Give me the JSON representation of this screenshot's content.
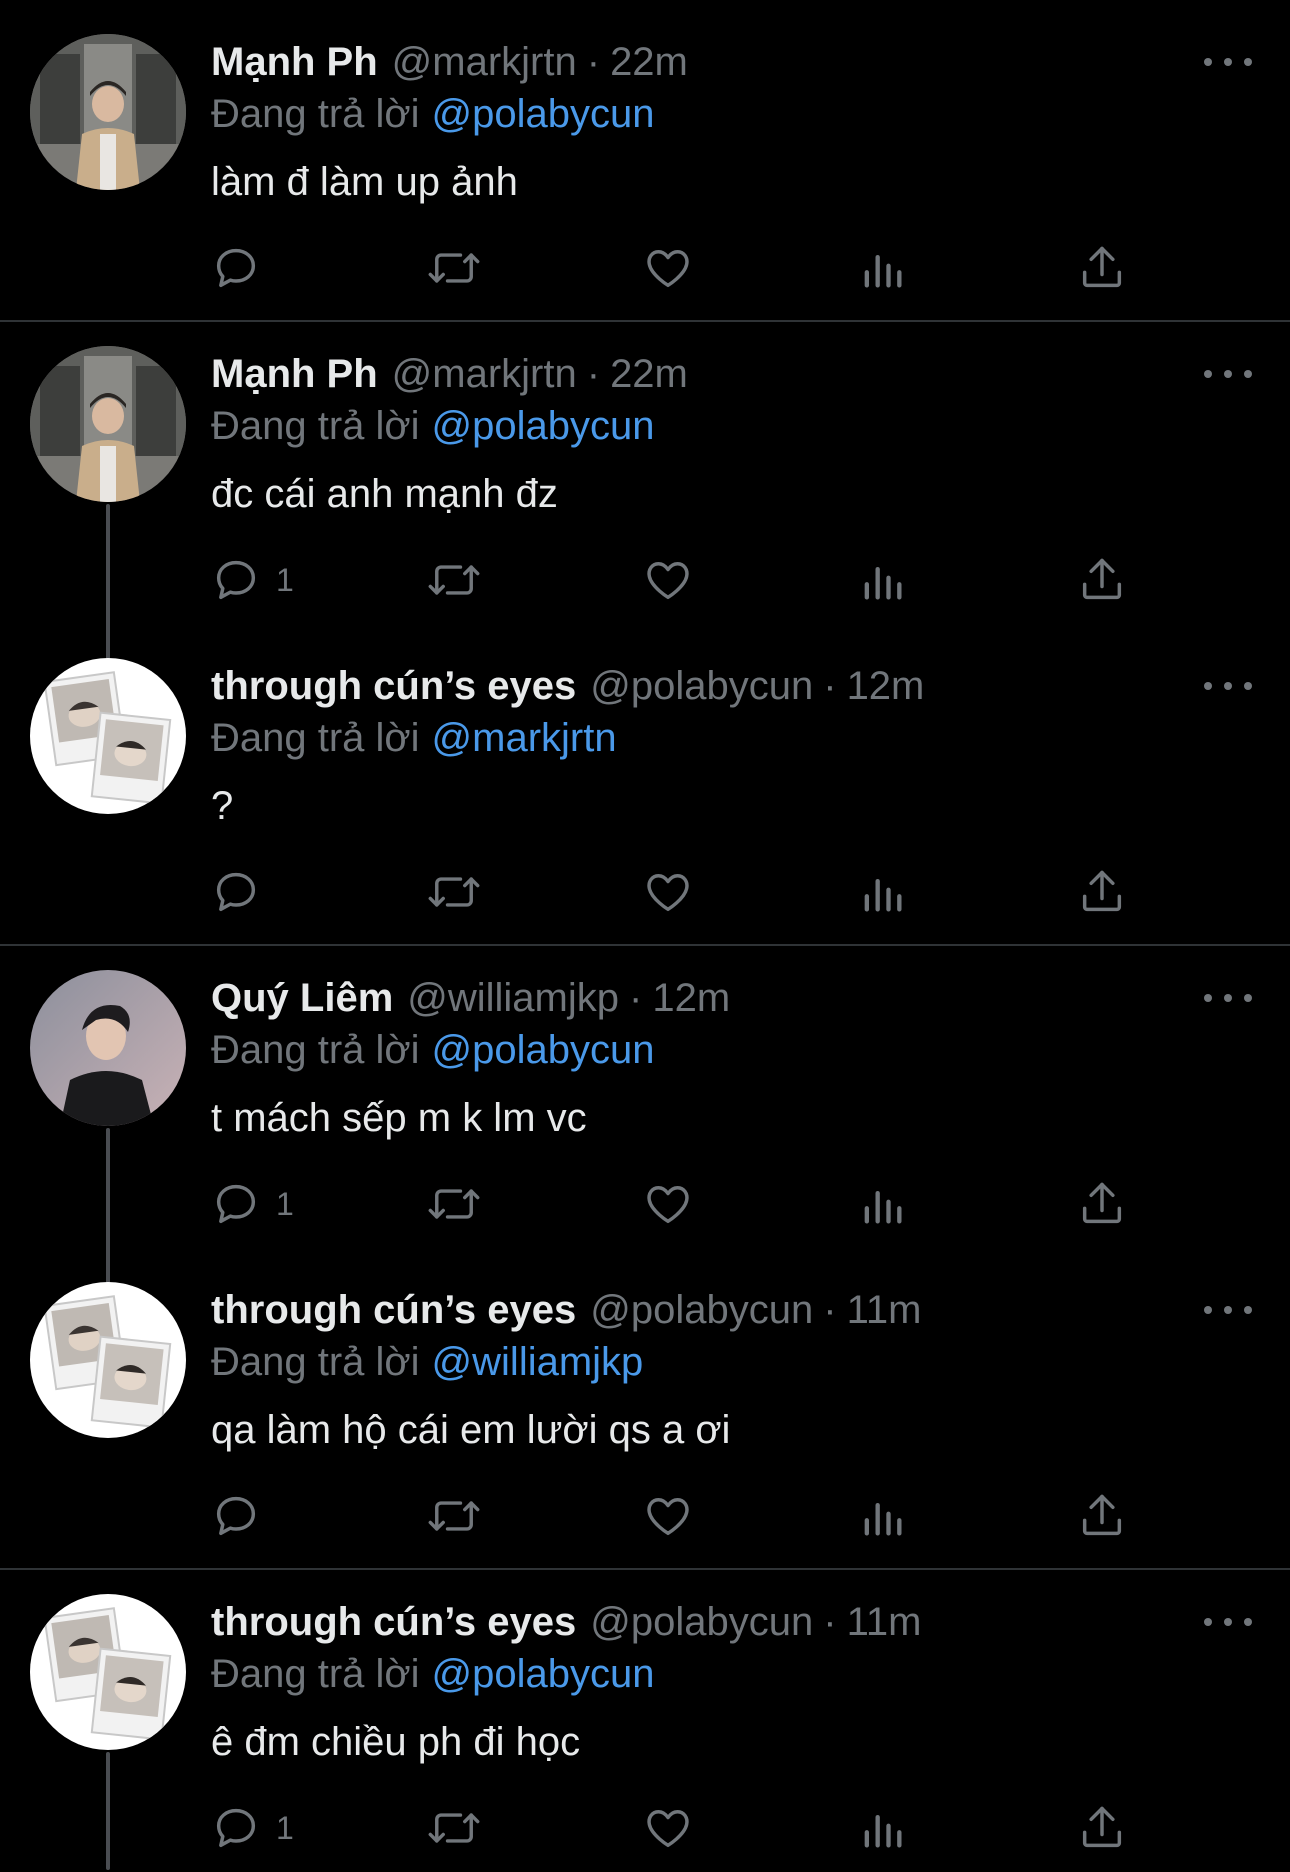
{
  "colors": {
    "background": "#000000",
    "primary_text": "#e7e9ea",
    "secondary_text": "#71767b",
    "mention": "#4a99e9",
    "divider": "#2f3336",
    "thread_line": "#4a4d52"
  },
  "icons": {
    "reply": "reply-icon",
    "retweet": "retweet-icon",
    "like": "heart-icon",
    "views": "views-icon",
    "share": "share-icon",
    "more": "more-icon"
  },
  "tweets": [
    {
      "name": "Mạnh Ph",
      "handle": "@markjrtn",
      "separator": "·",
      "time": "22m",
      "replying_label": "Đang trả lời",
      "replying_to": "@polabycun",
      "text": "làm đ làm up ảnh",
      "reply_count": ""
    },
    {
      "name": "Mạnh Ph",
      "handle": "@markjrtn",
      "separator": "·",
      "time": "22m",
      "replying_label": "Đang trả lời",
      "replying_to": "@polabycun",
      "text": "đc cái anh mạnh đz",
      "reply_count": "1"
    },
    {
      "name": "through cún’s eyes",
      "handle": "@polabycun",
      "separator": "·",
      "time": "12m",
      "replying_label": "Đang trả lời",
      "replying_to": "@markjrtn",
      "text": "?",
      "reply_count": ""
    },
    {
      "name": "Quý Liêm",
      "handle": "@williamjkp",
      "separator": "·",
      "time": "12m",
      "replying_label": "Đang trả lời",
      "replying_to": "@polabycun",
      "text": "t mách sếp m k lm vc",
      "reply_count": "1"
    },
    {
      "name": "through cún’s eyes",
      "handle": "@polabycun",
      "separator": "·",
      "time": "11m",
      "replying_label": "Đang trả lời",
      "replying_to": "@williamjkp",
      "text": "qa làm hộ cái em lười qs a ơi",
      "reply_count": ""
    },
    {
      "name": "through cún’s eyes",
      "handle": "@polabycun",
      "separator": "·",
      "time": "11m",
      "replying_label": "Đang trả lời",
      "replying_to": "@polabycun",
      "text": "ê đm chiều ph đi học",
      "reply_count": "1"
    }
  ]
}
